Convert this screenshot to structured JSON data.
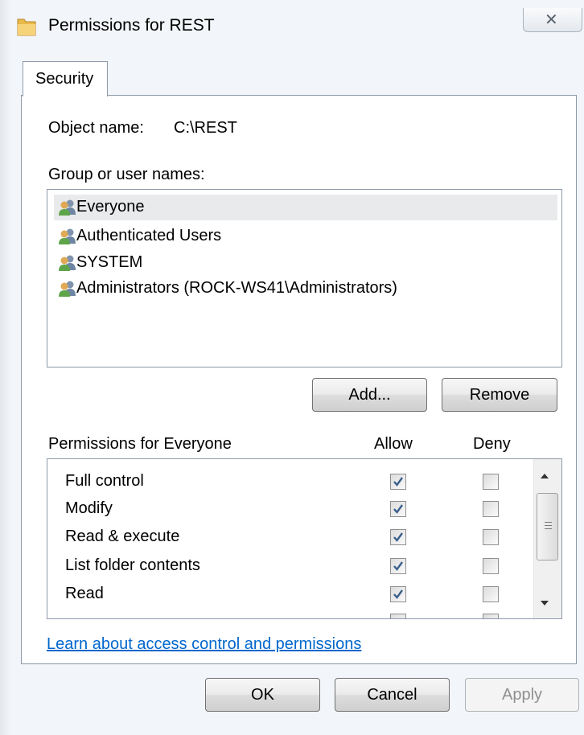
{
  "window": {
    "title": "Permissions for REST",
    "close_glyph": "✕"
  },
  "tabs": [
    {
      "label": "Security"
    }
  ],
  "object": {
    "label": "Object name:",
    "value": "C:\\REST"
  },
  "groups": {
    "label": "Group or user names:",
    "items": [
      {
        "label": "Everyone",
        "selected": true
      },
      {
        "label": "Authenticated Users"
      },
      {
        "label": "SYSTEM"
      },
      {
        "label": "Administrators (ROCK-WS41\\Administrators)"
      }
    ]
  },
  "buttons": {
    "add": "Add...",
    "remove": "Remove",
    "ok": "OK",
    "cancel": "Cancel",
    "apply": "Apply"
  },
  "permissions": {
    "header": "Permissions for Everyone",
    "allow_header": "Allow",
    "deny_header": "Deny",
    "items": [
      {
        "label": "Full control",
        "allow": true,
        "deny": false
      },
      {
        "label": "Modify",
        "allow": true,
        "deny": false
      },
      {
        "label": "Read & execute",
        "allow": true,
        "deny": false
      },
      {
        "label": "List folder contents",
        "allow": true,
        "deny": false
      },
      {
        "label": "Read",
        "allow": true,
        "deny": false
      }
    ]
  },
  "help_link": "Learn about access control and permissions",
  "icons": {
    "folder": "folder-icon",
    "user_group": "user-group-icon",
    "close": "close-icon"
  },
  "colors": {
    "link": "#0066cc",
    "checkmark": "#3b5f8c",
    "selection": "#e8eaec"
  }
}
